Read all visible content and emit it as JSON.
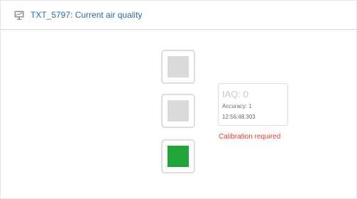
{
  "panel": {
    "title": "TXT_5797: Current air quality",
    "header_icon": "chart-monitor-icon"
  },
  "traffic_light": {
    "lights": [
      {
        "state": "off",
        "color": "#d9d9d9"
      },
      {
        "state": "off",
        "color": "#d9d9d9"
      },
      {
        "state": "on",
        "color": "#22a43a"
      }
    ]
  },
  "reading": {
    "iaq_text": "IAQ: 0",
    "accuracy_text": "Accuracy: 1",
    "time_text": "12:56:48.303"
  },
  "status": {
    "message": "Calibration required",
    "color": "#d43b3b"
  }
}
